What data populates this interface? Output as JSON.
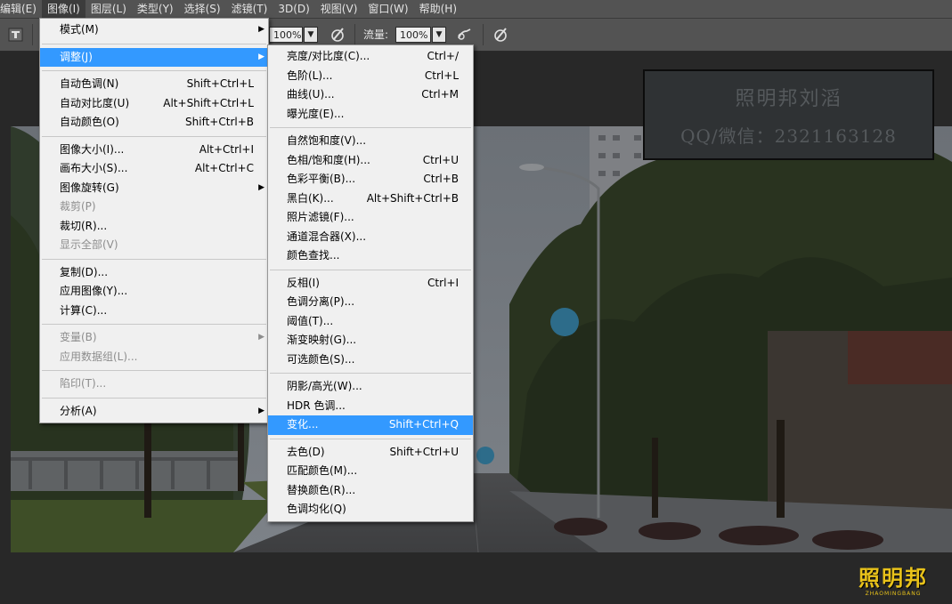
{
  "menubar": {
    "items": [
      "编辑(E)",
      "图像(I)",
      "图层(L)",
      "类型(Y)",
      "选择(S)",
      "滤镜(T)",
      "3D(D)",
      "视图(V)",
      "窗口(W)",
      "帮助(H)"
    ],
    "active": "图像(I)"
  },
  "options_bar": {
    "opacity_value": "100%",
    "flow_label": "流量:",
    "flow_value": "100%"
  },
  "image_menu": {
    "items": [
      {
        "label": "模式(M)",
        "shortcut": "",
        "submenu": true,
        "disabled": false
      },
      {
        "separator": true
      },
      {
        "label": "调整(J)",
        "shortcut": "",
        "submenu": true,
        "disabled": false,
        "highlight": true
      },
      {
        "separator": true
      },
      {
        "label": "自动色调(N)",
        "shortcut": "Shift+Ctrl+L"
      },
      {
        "label": "自动对比度(U)",
        "shortcut": "Alt+Shift+Ctrl+L"
      },
      {
        "label": "自动颜色(O)",
        "shortcut": "Shift+Ctrl+B"
      },
      {
        "separator": true
      },
      {
        "label": "图像大小(I)...",
        "shortcut": "Alt+Ctrl+I"
      },
      {
        "label": "画布大小(S)...",
        "shortcut": "Alt+Ctrl+C"
      },
      {
        "label": "图像旋转(G)",
        "shortcut": "",
        "submenu": true
      },
      {
        "label": "裁剪(P)",
        "shortcut": "",
        "disabled": true
      },
      {
        "label": "裁切(R)...",
        "shortcut": ""
      },
      {
        "label": "显示全部(V)",
        "shortcut": "",
        "disabled": true
      },
      {
        "separator": true
      },
      {
        "label": "复制(D)...",
        "shortcut": ""
      },
      {
        "label": "应用图像(Y)...",
        "shortcut": ""
      },
      {
        "label": "计算(C)...",
        "shortcut": ""
      },
      {
        "separator": true
      },
      {
        "label": "变量(B)",
        "shortcut": "",
        "submenu": true,
        "disabled": true
      },
      {
        "label": "应用数据组(L)...",
        "shortcut": "",
        "disabled": true
      },
      {
        "separator": true
      },
      {
        "label": "陷印(T)...",
        "shortcut": "",
        "disabled": true
      },
      {
        "separator": true
      },
      {
        "label": "分析(A)",
        "shortcut": "",
        "submenu": true
      }
    ]
  },
  "adjust_menu": {
    "items": [
      {
        "label": "亮度/对比度(C)...",
        "shortcut": "Ctrl+/"
      },
      {
        "label": "色阶(L)...",
        "shortcut": "Ctrl+L"
      },
      {
        "label": "曲线(U)...",
        "shortcut": "Ctrl+M"
      },
      {
        "label": "曝光度(E)...",
        "shortcut": ""
      },
      {
        "separator": true
      },
      {
        "label": "自然饱和度(V)...",
        "shortcut": ""
      },
      {
        "label": "色相/饱和度(H)...",
        "shortcut": "Ctrl+U"
      },
      {
        "label": "色彩平衡(B)...",
        "shortcut": "Ctrl+B"
      },
      {
        "label": "黑白(K)...",
        "shortcut": "Alt+Shift+Ctrl+B"
      },
      {
        "label": "照片滤镜(F)...",
        "shortcut": ""
      },
      {
        "label": "通道混合器(X)...",
        "shortcut": ""
      },
      {
        "label": "颜色查找...",
        "shortcut": ""
      },
      {
        "separator": true
      },
      {
        "label": "反相(I)",
        "shortcut": "Ctrl+I"
      },
      {
        "label": "色调分离(P)...",
        "shortcut": ""
      },
      {
        "label": "阈值(T)...",
        "shortcut": ""
      },
      {
        "label": "渐变映射(G)...",
        "shortcut": ""
      },
      {
        "label": "可选颜色(S)...",
        "shortcut": ""
      },
      {
        "separator": true
      },
      {
        "label": "阴影/高光(W)...",
        "shortcut": ""
      },
      {
        "label": "HDR 色调...",
        "shortcut": ""
      },
      {
        "label": "变化...",
        "shortcut": "Shift+Ctrl+Q",
        "highlight": true
      },
      {
        "separator": true
      },
      {
        "label": "去色(D)",
        "shortcut": "Shift+Ctrl+U"
      },
      {
        "label": "匹配颜色(M)...",
        "shortcut": ""
      },
      {
        "label": "替换颜色(R)...",
        "shortcut": ""
      },
      {
        "label": "色调均化(Q)",
        "shortcut": ""
      }
    ]
  },
  "watermark": {
    "line1": "照明邦刘滔",
    "line2": "QQ/微信：2321163128"
  },
  "logo": {
    "text": "照明邦",
    "subtext": "ZHAOMINGBANG"
  },
  "colors": {
    "menubar_bg": "#535353",
    "menu_bg": "#f0f0f0",
    "highlight": "#3399ff",
    "logo": "#e8c21a"
  }
}
